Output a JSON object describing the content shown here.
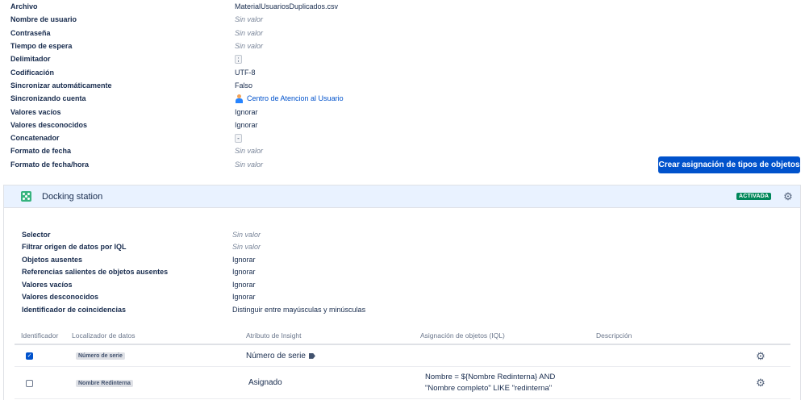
{
  "config": [
    {
      "key": "Archivo",
      "value": "MaterialUsuariosDuplicados.csv",
      "kind": "text"
    },
    {
      "key": "Nombre de usuario",
      "value": "Sin valor",
      "kind": "empty"
    },
    {
      "key": "Contraseña",
      "value": "Sin valor",
      "kind": "empty"
    },
    {
      "key": "Tiempo de espera",
      "value": "Sin valor",
      "kind": "empty"
    },
    {
      "key": "Delimitador",
      "value": ";",
      "kind": "chip"
    },
    {
      "key": "Codificación",
      "value": "UTF-8",
      "kind": "text"
    },
    {
      "key": "Sincronizar automáticamente",
      "value": "Falso",
      "kind": "text"
    },
    {
      "key": "Sincronizando cuenta",
      "value": "Centro de Atencion al Usuario",
      "kind": "link"
    },
    {
      "key": "Valores vacíos",
      "value": "Ignorar",
      "kind": "text"
    },
    {
      "key": "Valores desconocidos",
      "value": "Ignorar",
      "kind": "text"
    },
    {
      "key": "Concatenador",
      "value": "-",
      "kind": "chip"
    },
    {
      "key": "Formato de fecha",
      "value": "Sin valor",
      "kind": "empty"
    },
    {
      "key": "Formato de fecha/hora",
      "value": "Sin valor",
      "kind": "empty"
    }
  ],
  "create_button_label": "Crear asignación de tipos de objetos",
  "docking": {
    "title": "Docking station",
    "status": "ACTIVADA",
    "settings": [
      {
        "key": "Selector",
        "value": "Sin valor",
        "kind": "empty"
      },
      {
        "key": "Filtrar origen de datos por IQL",
        "value": "Sin valor",
        "kind": "empty"
      },
      {
        "key": "Objetos ausentes",
        "value": "Ignorar",
        "kind": "text"
      },
      {
        "key": "Referencias salientes de objetos ausentes",
        "value": "Ignorar",
        "kind": "text"
      },
      {
        "key": "Valores vacíos",
        "value": "Ignorar",
        "kind": "text"
      },
      {
        "key": "Valores desconocidos",
        "value": "Ignorar",
        "kind": "text"
      },
      {
        "key": "Identificador de coincidencias",
        "value": "Distinguir entre mayúsculas y minúsculas",
        "kind": "text"
      }
    ],
    "table": {
      "headers": {
        "identifier": "Identificador",
        "locator": "Localizador de datos",
        "attribute": "Atributo de Insight",
        "iql": "Asignación de objetos (IQL)",
        "description": "Descripción"
      },
      "rows": [
        {
          "checked": true,
          "locator": "Número de serie",
          "attribute": "Número de serie",
          "iql_line1": "",
          "iql_line2": ""
        },
        {
          "checked": false,
          "locator": "Nombre Redinterna",
          "attribute": "Asignado",
          "iql_line1": "Nombre = ${Nombre Redinterna} AND",
          "iql_line2": "\"Nombre completo\" LIKE \"redinterna\""
        }
      ]
    }
  },
  "colors": {
    "primary": "#0052cc",
    "status_green": "#00875a",
    "header_bg": "#e9f2ff"
  }
}
